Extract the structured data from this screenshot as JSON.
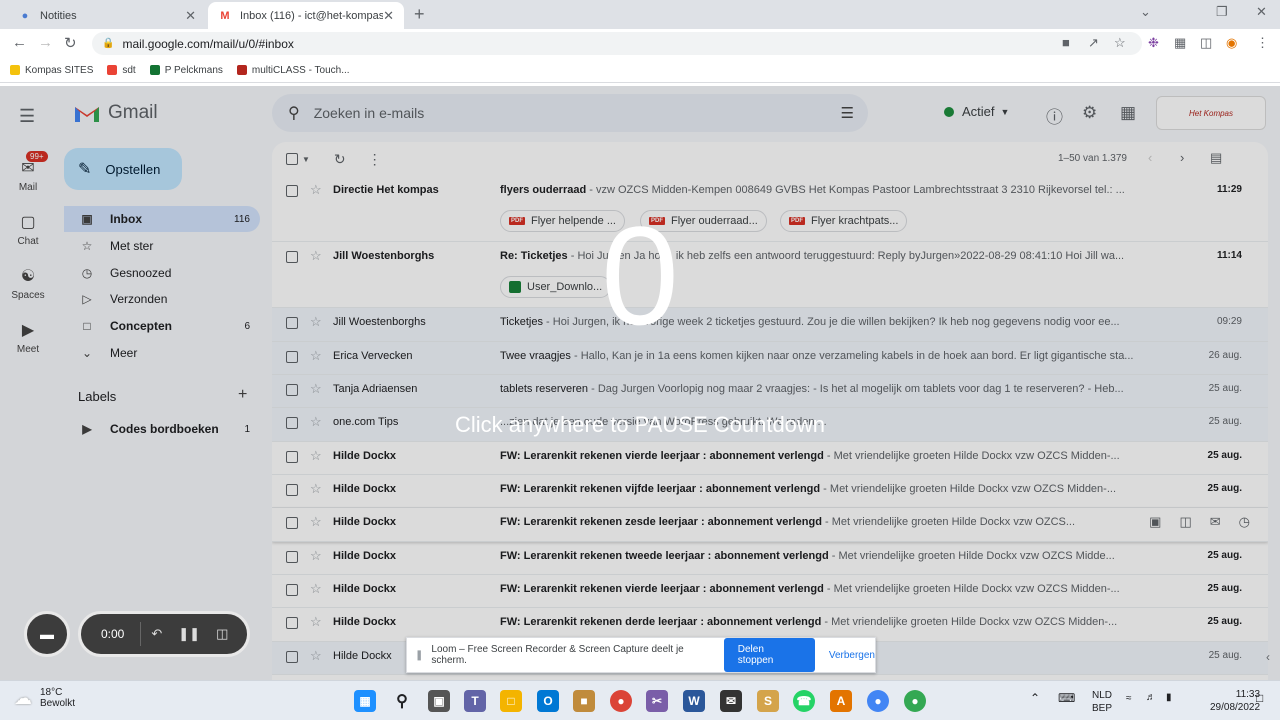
{
  "browser": {
    "tabs": [
      {
        "title": "Notities",
        "icon": "people-icon"
      },
      {
        "title": "Inbox (116) - ict@het-kompas.be",
        "icon": "gmail-icon"
      }
    ],
    "url": "mail.google.com/mail/u/0/#inbox",
    "bookmarks": [
      {
        "label": "Kompas SITES",
        "color": "#f4c20d"
      },
      {
        "label": "sdt",
        "color": "#ea4335"
      },
      {
        "label": "P Pelckmans",
        "color": "#137333"
      },
      {
        "label": "multiCLASS - Touch...",
        "color": "#b3261e"
      }
    ]
  },
  "gmail": {
    "brand": "Gmail",
    "search_placeholder": "Zoeken in e-mails",
    "status": "Actief",
    "account_logo_text": "Het Kompas",
    "rail": [
      {
        "label": "Mail",
        "badge": "99+"
      },
      {
        "label": "Chat"
      },
      {
        "label": "Spaces"
      },
      {
        "label": "Meet"
      }
    ],
    "compose": "Opstellen",
    "folders": [
      {
        "label": "Inbox",
        "count": "116"
      },
      {
        "label": "Met ster",
        "count": ""
      },
      {
        "label": "Gesnoozed",
        "count": ""
      },
      {
        "label": "Verzonden",
        "count": ""
      },
      {
        "label": "Concepten",
        "count": "6"
      },
      {
        "label": "Meer",
        "count": ""
      }
    ],
    "labels_heading": "Labels",
    "labels": [
      {
        "label": "Codes bordboeken",
        "count": "1"
      }
    ],
    "page_info": "1–50 van 1.379",
    "emails": [
      {
        "sender": "Directie Het kompas",
        "subject": "flyers ouderraad",
        "snippet": " - vzw OZCS Midden-Kempen 008649 GVBS Het Kompas Pastoor Lambrechtsstraat 3 2310 Rijkevorsel tel.: ...",
        "date": "11:29",
        "unread": true,
        "attachments": [
          "Flyer helpende ...",
          "Flyer ouderraad...",
          "Flyer krachtpats..."
        ]
      },
      {
        "sender": "Jill Woestenborghs",
        "subject": "Re: Ticketjes",
        "snippet": " - Hoi Jurgen Ja hoor, ik heb zelfs een antwoord teruggestuurd: Reply byJurgen»2022-08-29 08:41:10 Hoi Jill wa...",
        "date": "11:14",
        "unread": true,
        "attachments": [
          "User_Downlo..."
        ]
      },
      {
        "sender": "Jill Woestenborghs",
        "subject": "Ticketjes",
        "snippet": " - Hoi Jurgen, ik heb vorige week 2 ticketjes gestuurd. Zou je die willen bekijken? Ik heb nog gegevens nodig voor ee...",
        "date": "09:29",
        "unread": false,
        "attachments": []
      },
      {
        "sender": "Erica Vervecken",
        "subject": "Twee vraagjes",
        "snippet": " - Hallo, Kan je in 1a eens komen kijken naar onze verzameling kabels in de hoek aan bord. Er ligt gigantische sta...",
        "date": "26 aug.",
        "unread": false,
        "attachments": []
      },
      {
        "sender": "Tanja Adriaensen",
        "subject": "tablets reserveren",
        "snippet": " - Dag Jurgen Voorlopig nog maar 2 vraagjes: - Is het al mogelijk om tablets voor dag 1 te reserveren? - Heb...",
        "date": "25 aug.",
        "unread": false,
        "attachments": []
      },
      {
        "sender": "one.com Tips",
        "subject": "",
        "snippet": "...zien dat je een oude versie van WordPress gebruikt. We raden ...",
        "date": "25 aug.",
        "unread": false,
        "attachments": []
      },
      {
        "sender": "Hilde Dockx",
        "subject": "FW: Lerarenkit rekenen vierde leerjaar : abonnement verlengd",
        "snippet": " - Met vriendelijke groeten Hilde Dockx vzw OZCS Midden-...",
        "date": "25 aug.",
        "unread": true,
        "attachments": []
      },
      {
        "sender": "Hilde Dockx",
        "subject": "FW: Lerarenkit rekenen vijfde leerjaar : abonnement verlengd",
        "snippet": " - Met vriendelijke groeten Hilde Dockx vzw OZCS Midden-...",
        "date": "25 aug.",
        "unread": true,
        "attachments": []
      },
      {
        "sender": "Hilde Dockx",
        "subject": "FW: Lerarenkit rekenen zesde leerjaar : abonnement verlengd",
        "snippet": " - Met vriendelijke groeten Hilde Dockx vzw OZCS...",
        "date": "",
        "unread": true,
        "attachments": [],
        "hover": true
      },
      {
        "sender": "Hilde Dockx",
        "subject": "FW: Lerarenkit rekenen tweede leerjaar : abonnement verlengd",
        "snippet": " - Met vriendelijke groeten Hilde Dockx vzw OZCS Midde...",
        "date": "25 aug.",
        "unread": true,
        "attachments": []
      },
      {
        "sender": "Hilde Dockx",
        "subject": "FW: Lerarenkit rekenen vierde leerjaar : abonnement verlengd",
        "snippet": " - Met vriendelijke groeten Hilde Dockx vzw OZCS Midden-...",
        "date": "25 aug.",
        "unread": true,
        "attachments": []
      },
      {
        "sender": "Hilde Dockx",
        "subject": "FW: Lerarenkit rekenen derde leerjaar : abonnement verlengd",
        "snippet": " - Met vriendelijke groeten Hilde Dockx vzw OZCS Midden-...",
        "date": "25 aug.",
        "unread": true,
        "attachments": []
      },
      {
        "sender": "Hilde Dockx",
        "subject": "",
        "snippet": "...lijke groeten Hilde Dockx vzw OZCS Midden-Ke...",
        "date": "25 aug.",
        "unread": false,
        "attachments": []
      }
    ]
  },
  "loom": {
    "countdown": "0",
    "hint": "Click anywhere to PAUSE Countdown",
    "timer": "0:00",
    "share_text": "Loom – Free Screen Recorder & Screen Capture deelt je scherm.",
    "stop_label": "Delen stoppen",
    "hide_label": "Verbergen"
  },
  "taskbar": {
    "temperature": "18°C",
    "weather": "Bewolkt",
    "language_1": "NLD",
    "language_2": "BEP",
    "time": "11:33",
    "date": "29/08/2022"
  }
}
